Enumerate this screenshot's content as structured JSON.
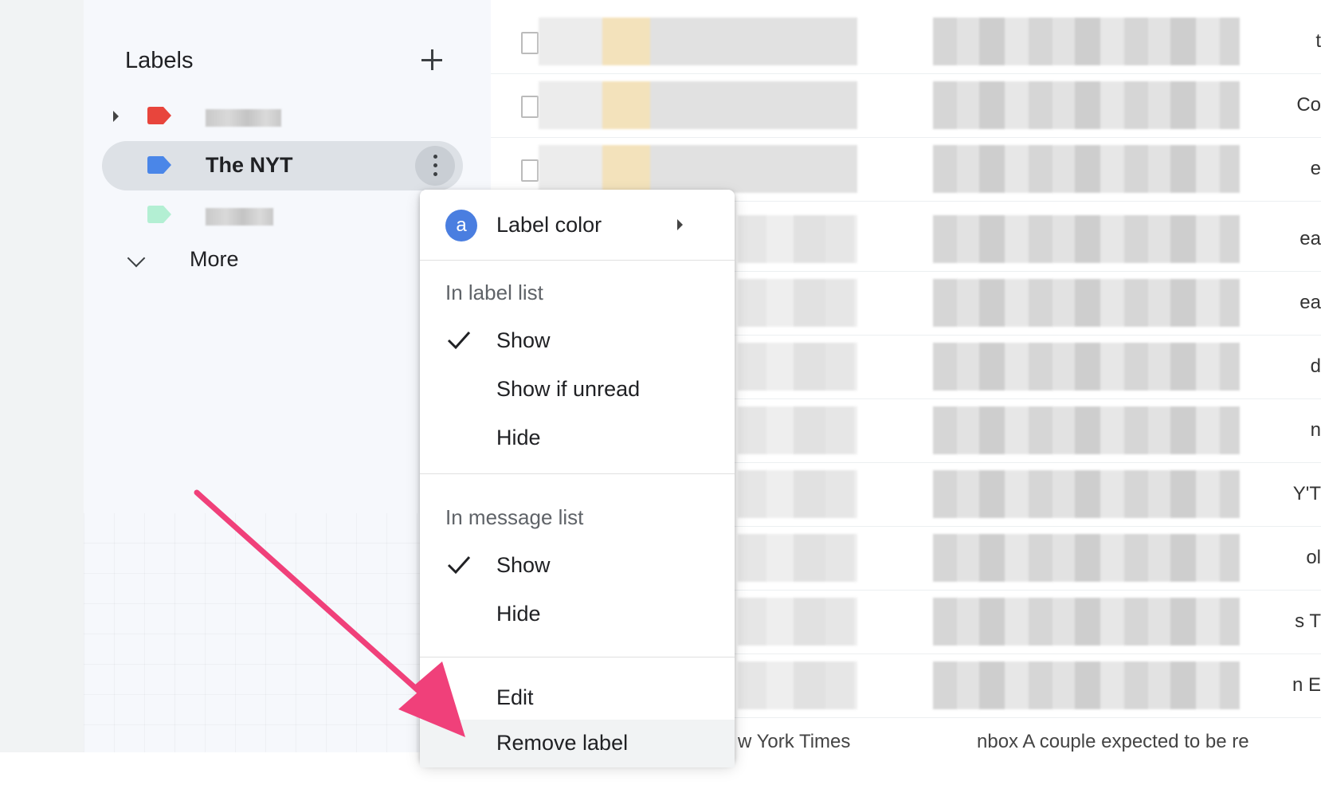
{
  "sidebar": {
    "title": "Labels",
    "labels": [
      {
        "name": "",
        "color": "#e8453c"
      },
      {
        "name": "The NYT",
        "color": "#4a86e8"
      },
      {
        "name": "",
        "color": "#b3efd3"
      }
    ],
    "more_label": "More"
  },
  "context_menu": {
    "label_color": {
      "avatar_letter": "a",
      "label": "Label color",
      "color": "#4a7ee0"
    },
    "sections": [
      {
        "title": "In label list",
        "items": [
          "Show",
          "Show if unread",
          "Hide"
        ],
        "checked": "Show"
      },
      {
        "title": "In message list",
        "items": [
          "Show",
          "Hide"
        ],
        "checked": "Show"
      }
    ],
    "edit_label": "Edit",
    "remove_label": "Remove label"
  },
  "message_list": {
    "bottom_row_left": "w York Times",
    "bottom_row_right": "nbox A couple expected to be re",
    "edge_chars": [
      "t",
      "Co",
      "e",
      "ea",
      "ea",
      "d",
      "n",
      "Y'T",
      "ol",
      "s T",
      "n E"
    ]
  },
  "annotation": {
    "arrow_color": "#f0407a"
  }
}
